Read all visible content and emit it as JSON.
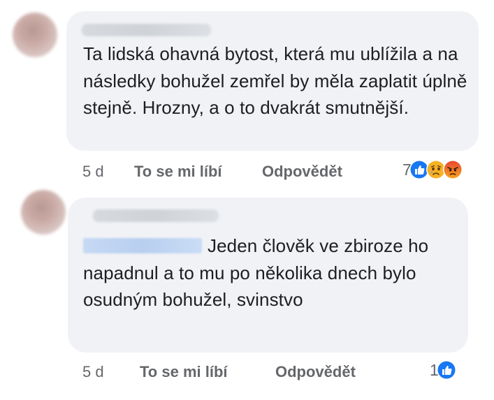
{
  "comments": [
    {
      "text": "Ta lidská ohavná bytost, která mu ublížila a na následky bohužel zemřel by měla zaplatit úplně stejně. Hrozny, a o to dvakrát smutnější.",
      "age": "5 d",
      "like_label": "To se mi líbí",
      "reply_label": "Odpovědět",
      "reaction_count": "7",
      "reactions": [
        "like-icon",
        "sad-icon",
        "angry-icon"
      ]
    },
    {
      "text": "Jeden člověk ve zbiroze ho napadnul a to mu po několika dnech bylo osudným bohužel, svinstvo",
      "age": "5 d",
      "like_label": "To se mi líbí",
      "reply_label": "Odpovědět",
      "reaction_count": "1",
      "reactions": [
        "like-icon"
      ]
    }
  ],
  "colors": {
    "bubble": "#f0f2f5",
    "text": "#1c1e21",
    "meta": "#65676b",
    "like": "#1877f2"
  }
}
